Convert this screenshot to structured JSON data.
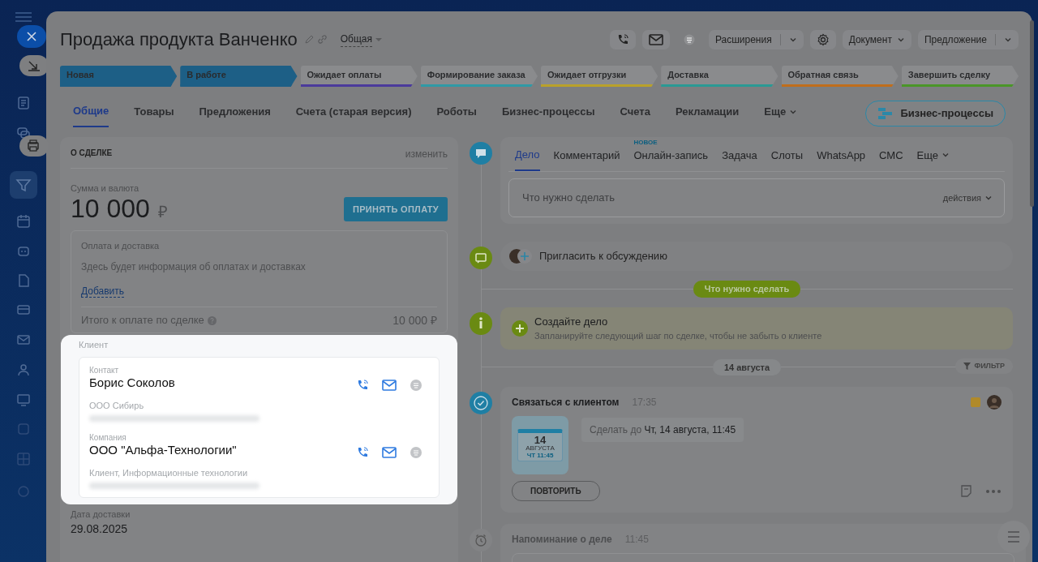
{
  "title": "Продажа продукта Ванченко",
  "category": "Общая",
  "header_actions": [
    {
      "label": "Расширения",
      "split": true
    },
    {
      "label": "Документ",
      "split": false
    },
    {
      "label": "Предложение",
      "split": true
    }
  ],
  "stages": [
    {
      "label": "Новая",
      "passed": true,
      "color": "#1d5f86"
    },
    {
      "label": "В работе",
      "passed": true,
      "color": "#1d5f86"
    },
    {
      "label": "Ожидает оплаты",
      "passed": false,
      "color": "#4b3a9c"
    },
    {
      "label": "Формирование заказа",
      "passed": false,
      "color": "#2f9aa6"
    },
    {
      "label": "Ожидает отгрузки",
      "passed": false,
      "color": "#b9a12a"
    },
    {
      "label": "Доставка",
      "passed": false,
      "color": "#2a9a94"
    },
    {
      "label": "Обратная связь",
      "passed": false,
      "color": "#c06e1c"
    },
    {
      "label": "Завершить сделку",
      "passed": false,
      "color": "#4a9628"
    }
  ],
  "tabs": [
    {
      "label": "Общие",
      "selected": true
    },
    {
      "label": "Товары",
      "selected": false
    },
    {
      "label": "Предложения",
      "selected": false
    },
    {
      "label": "Счета (старая версия)",
      "selected": false
    },
    {
      "label": "Роботы",
      "selected": false
    },
    {
      "label": "Бизнес-процессы",
      "selected": false
    },
    {
      "label": "Счета",
      "selected": false
    },
    {
      "label": "Рекламации",
      "selected": false
    },
    {
      "label": "Еще",
      "selected": false
    }
  ],
  "bp_button": "Бизнес-процессы",
  "deal": {
    "heading": "О СДЕЛКЕ",
    "edit": "изменить",
    "amount_label": "Сумма и валюта",
    "amount": "10 000",
    "currency": "₽",
    "pay_button": "ПРИНЯТЬ ОПЛАТУ",
    "payment": {
      "title": "Оплата и доставка",
      "text": "Здесь будет информация об оплатах и доставках",
      "add": "Добавить",
      "total_label": "Итого к оплате по сделке",
      "total": "10 000 ₽"
    }
  },
  "client": {
    "heading": "Клиент",
    "entries": [
      {
        "type_label": "Контакт",
        "name": "Борис Соколов",
        "detail": "ООО Сибирь"
      },
      {
        "type_label": "Компания",
        "name": "ООО \"Альфа-Технологии\"",
        "detail": "Клиент, Информационные технологии"
      }
    ]
  },
  "delivery": {
    "label": "Дата доставки",
    "value": "29.08.2025"
  },
  "activity": {
    "tabs": [
      {
        "label": "Дело",
        "selected": true
      },
      {
        "label": "Комментарий",
        "selected": false
      },
      {
        "label": "Онлайн-запись",
        "selected": false,
        "badge": "НОВОЕ"
      },
      {
        "label": "Задача",
        "selected": false
      },
      {
        "label": "Слоты",
        "selected": false
      },
      {
        "label": "WhatsApp",
        "selected": false
      },
      {
        "label": "СМС",
        "selected": false
      },
      {
        "label": "Еще",
        "selected": false
      }
    ],
    "placeholder": "Что нужно сделать",
    "actions": "действия"
  },
  "invite": "Пригласить к обсуждению",
  "todo_divider": "Что нужно сделать",
  "create": {
    "title": "Создайте дело",
    "text": "Запланируйте следующий шаг по сделке, чтобы не забыть о клиенте"
  },
  "date_divider": "14 августа",
  "filter": "ФИЛЬТР",
  "task": {
    "title": "Связаться с клиентом",
    "time": "17:35",
    "cal_day": "14",
    "cal_month": "АВГУСТА",
    "cal_time": "ЧТ 11:45",
    "deadline_prefix": "Сделать до",
    "deadline": "Чт, 14 августа, 11:45",
    "repeat": "ПОВТОРИТЬ"
  },
  "reminder": {
    "title": "Напоминание о деле",
    "time": "11:45"
  }
}
